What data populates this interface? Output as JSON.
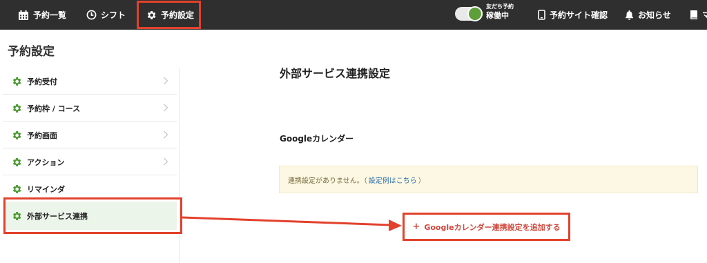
{
  "topbar": {
    "nav": [
      {
        "label": "予約一覧",
        "icon": "calendar-icon"
      },
      {
        "label": "シフト",
        "icon": "clock-icon"
      },
      {
        "label": "予約設定",
        "icon": "gear-icon"
      }
    ],
    "status_small": "友だち予約",
    "status_big": "稼働中",
    "site_label": "予約サイト確認",
    "news_label": "お知らせ",
    "more_label": "マ"
  },
  "page": {
    "title": "予約設定"
  },
  "sidebar": {
    "items": [
      {
        "label": "予約受付",
        "chevron": true
      },
      {
        "label": "予約枠 / コース",
        "chevron": true
      },
      {
        "label": "予約画面",
        "chevron": true
      },
      {
        "label": "アクション",
        "chevron": true
      },
      {
        "label": "リマインダ",
        "chevron": false
      },
      {
        "label": "外部サービス連携",
        "chevron": false,
        "active": true
      }
    ]
  },
  "main": {
    "title": "外部サービス連携設定",
    "section_title": "Googleカレンダー",
    "notice_text": "連携設定がありません。（",
    "notice_link": "設定例はこちら",
    "notice_close": "）",
    "add_plus": "+",
    "add_label": "Googleカレンダー連携設定を追加する"
  },
  "colors": {
    "topbar": "#2f2f2f",
    "highlight": "#e2412c",
    "gear_green": "#4a9a2f",
    "toggle_green": "#5da03a",
    "notice_bg": "#fcf8e4",
    "link_blue": "#2d6ea8",
    "add_red": "#d0463b"
  }
}
